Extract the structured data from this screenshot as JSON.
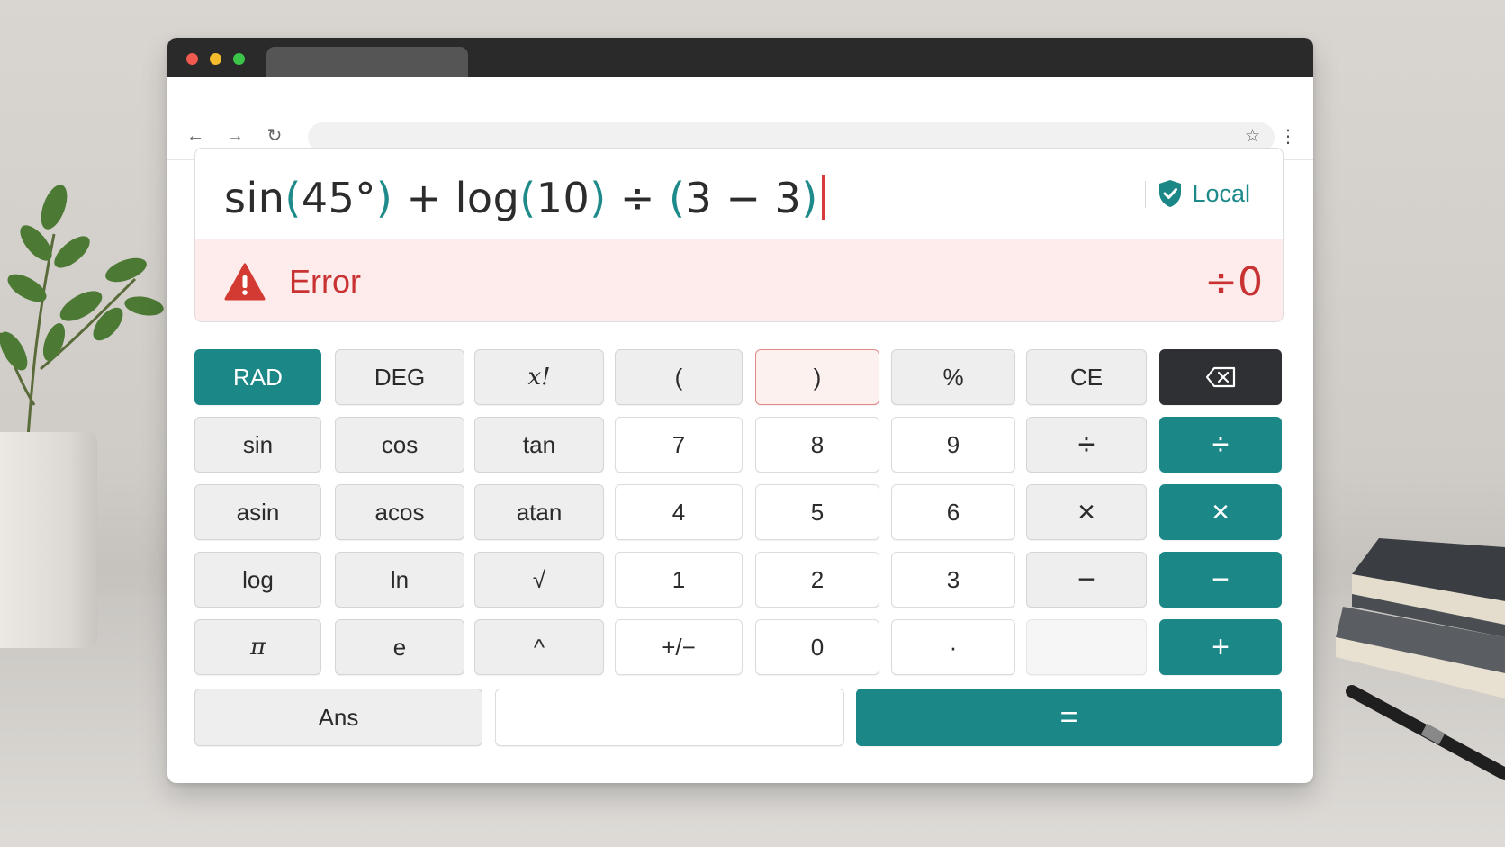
{
  "display": {
    "expression": {
      "fn1": "sin",
      "open1": "(",
      "arg1": "45°",
      "close1": ")",
      "op1": "+",
      "fn2": "log",
      "open2": "(",
      "arg2": "10",
      "close2": ")",
      "op2": "÷",
      "open3": "(",
      "arg3": "3 − 3",
      "close3": ")"
    },
    "mode_badge": "Local",
    "error_label": "Error",
    "error_code": "÷0"
  },
  "keypad": {
    "rad": "RAD",
    "deg": "DEG",
    "factorial": "x!",
    "paren_open": "(",
    "paren_close": ")",
    "percent": "%",
    "clear_entry": "CE",
    "sin": "sin",
    "cos": "cos",
    "tan": "tan",
    "seven": "7",
    "eight": "8",
    "nine": "9",
    "divide_alt": "÷",
    "divide": "÷",
    "asin": "asin",
    "acos": "acos",
    "atan": "atan",
    "four": "4",
    "five": "5",
    "six": "6",
    "multiply_alt": "×",
    "multiply": "×",
    "log": "log",
    "ln": "ln",
    "sqrt": "√",
    "one": "1",
    "two": "2",
    "three": "3",
    "minus_alt": "−",
    "minus": "−",
    "pi": "π",
    "e": "e",
    "power": "^",
    "sign": "+/−",
    "zero": "0",
    "decimal": "·",
    "plus": "+",
    "ans": "Ans",
    "equals": "="
  },
  "colors": {
    "accent": "#1b8787",
    "error": "#c83232",
    "error_bg": "#fdeceb"
  },
  "icons": [
    "back-arrow-icon",
    "forward-arrow-icon",
    "reload-icon",
    "star-icon",
    "kebab-menu-icon",
    "shield-check-icon",
    "warning-icon",
    "backspace-icon"
  ]
}
